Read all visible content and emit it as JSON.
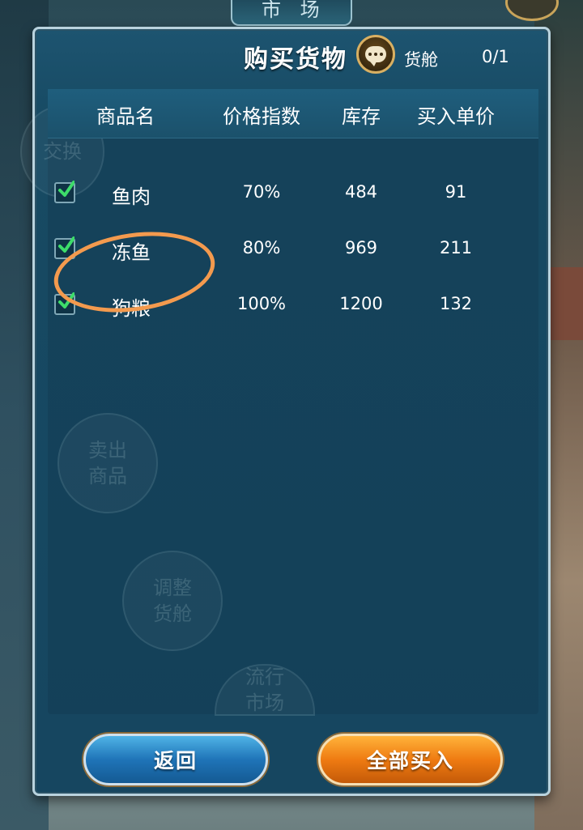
{
  "top_tab": {
    "label": "市 场"
  },
  "dialog": {
    "title": "购买货物",
    "cargo_label": "货舱",
    "cargo_value": "0/1"
  },
  "table": {
    "headers": [
      "商品名",
      "价格指数",
      "库存",
      "买入单价"
    ],
    "rows": [
      {
        "checked": true,
        "name": "鱼肉",
        "price_index": "70%",
        "stock": "484",
        "buy_price": "91"
      },
      {
        "checked": true,
        "name": "冻鱼",
        "price_index": "80%",
        "stock": "969",
        "buy_price": "211"
      },
      {
        "checked": true,
        "name": "狗粮",
        "price_index": "100%",
        "stock": "1200",
        "buy_price": "132"
      }
    ]
  },
  "background_menu": [
    "交换",
    "卖出商品",
    "调整货舱",
    "流行市场"
  ],
  "buttons": {
    "back": "返回",
    "buy_all": "全部买入"
  },
  "colors": {
    "annotation_circle": "#f39a4e",
    "back_button": "#1f74b8",
    "buy_all_button": "#ef7b12",
    "check": "#3ddc6a"
  },
  "icons": {
    "chat": "chat-bubble-icon",
    "check": "checkmark-icon"
  }
}
